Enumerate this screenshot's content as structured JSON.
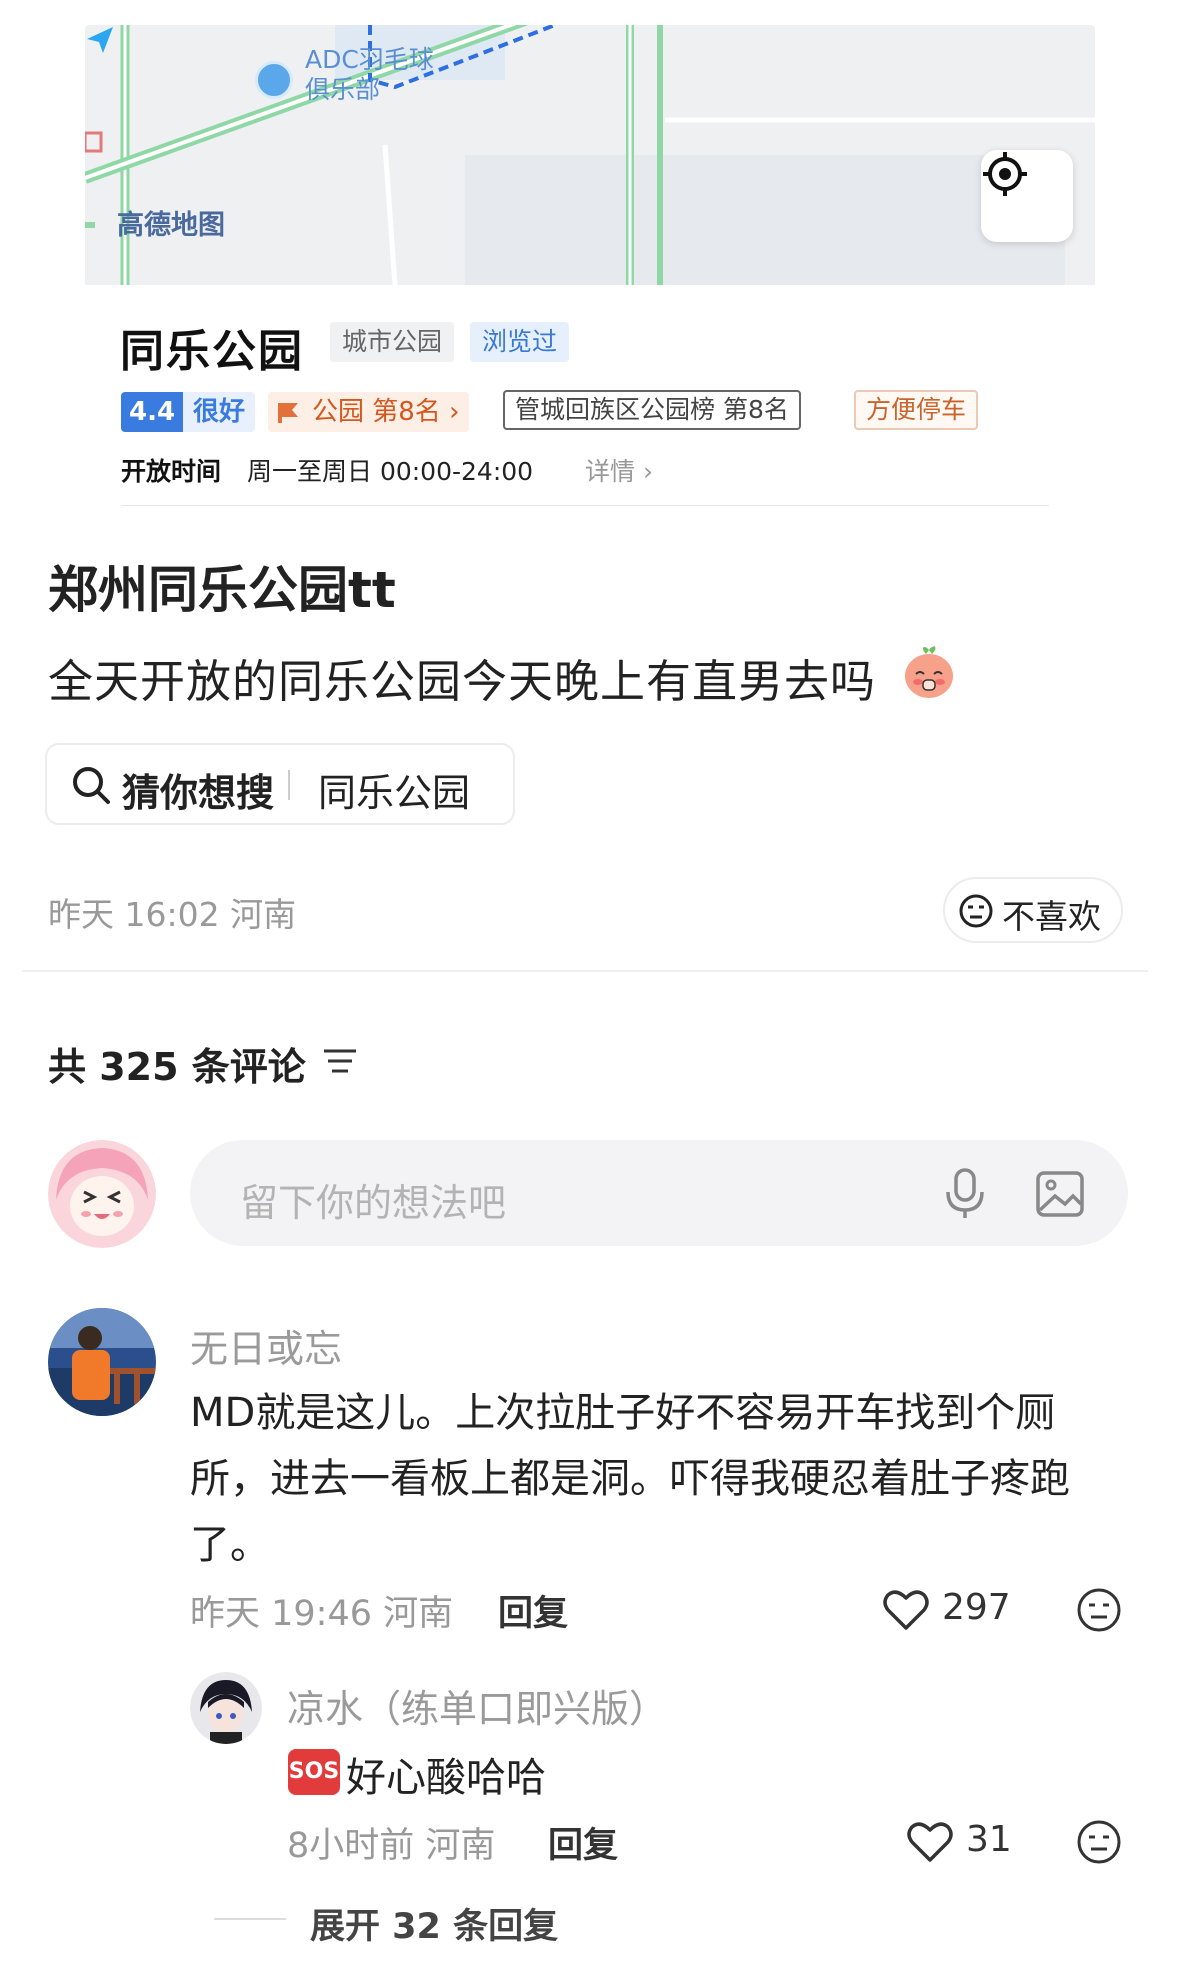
{
  "map": {
    "poi_label": "ADC羽毛球\n俱乐部",
    "logo_text": "高德地图",
    "locate_icon": "locate-crosshair-icon",
    "colors": {
      "road": "#8fd8a6",
      "route": "#2d6fe0",
      "land": "#eef0f2"
    }
  },
  "poi": {
    "name": "同乐公园",
    "category": "城市公园",
    "viewed": "浏览过",
    "rating_score": "4.4",
    "rating_text": "很好",
    "rank": "公园 第8名 ›",
    "board": "管城回族区公园榜 第8名",
    "parking": "方便停车",
    "hours_label": "开放时间",
    "hours_value": "周一至周日 00:00-24:00",
    "hours_detail": "详情 ›"
  },
  "post": {
    "title": "郑州同乐公园tt",
    "body": "全天开放的同乐公园今天晚上有直男去吗",
    "search_label": "猜你想搜",
    "search_query": "同乐公园",
    "meta": "昨天 16:02 河南",
    "dislike_label": "不喜欢"
  },
  "comments_header": {
    "count_text": "共 325 条评论",
    "input_placeholder": "留下你的想法吧"
  },
  "comments": [
    {
      "name": "无日或忘",
      "text": "MD就是这儿。上次拉肚子好不容易开车找到个厕所，进去一看板上都是洞。吓得我硬忍着肚子疼跑了。",
      "meta": "昨天 19:46 河南",
      "reply_label": "回复",
      "likes": "297"
    }
  ],
  "replies": [
    {
      "name": "凉水（练单口即兴版）",
      "badge": "SOS",
      "text": "好心酸哈哈",
      "meta": "8小时前 河南",
      "reply_label": "回复",
      "likes": "31"
    }
  ],
  "expand": {
    "text": "展开 32 条回复"
  }
}
